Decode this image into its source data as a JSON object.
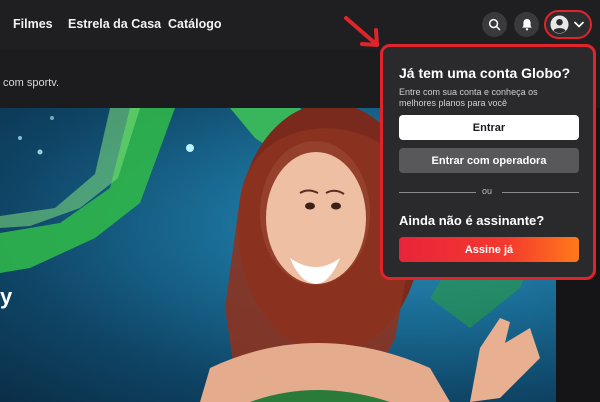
{
  "nav": {
    "items": [
      {
        "label": "Filmes"
      },
      {
        "label": "Estrela da Casa"
      },
      {
        "label": "Catálogo"
      }
    ]
  },
  "header": {
    "subline": "com sportv."
  },
  "icons": {
    "search": "search-icon",
    "bell": "bell-icon",
    "avatar": "avatar-icon",
    "chevron": "chevron-down-icon"
  },
  "hero": {
    "partial_letter": "y"
  },
  "dropdown": {
    "title": "Já tem uma conta Globo?",
    "description": "Entre com sua conta e conheça os melhores planos para você",
    "login_button": "Entrar",
    "operator_button": "Entrar com operadora",
    "divider_text": "ou",
    "subtitle": "Ainda não é assinante?",
    "subscribe_button": "Assine já"
  },
  "colors": {
    "accent_red": "#e0242b",
    "subscribe_gradient_start": "#e8243a",
    "subscribe_gradient_end": "#ff7a1a",
    "panel_bg": "#2a2a2c"
  }
}
